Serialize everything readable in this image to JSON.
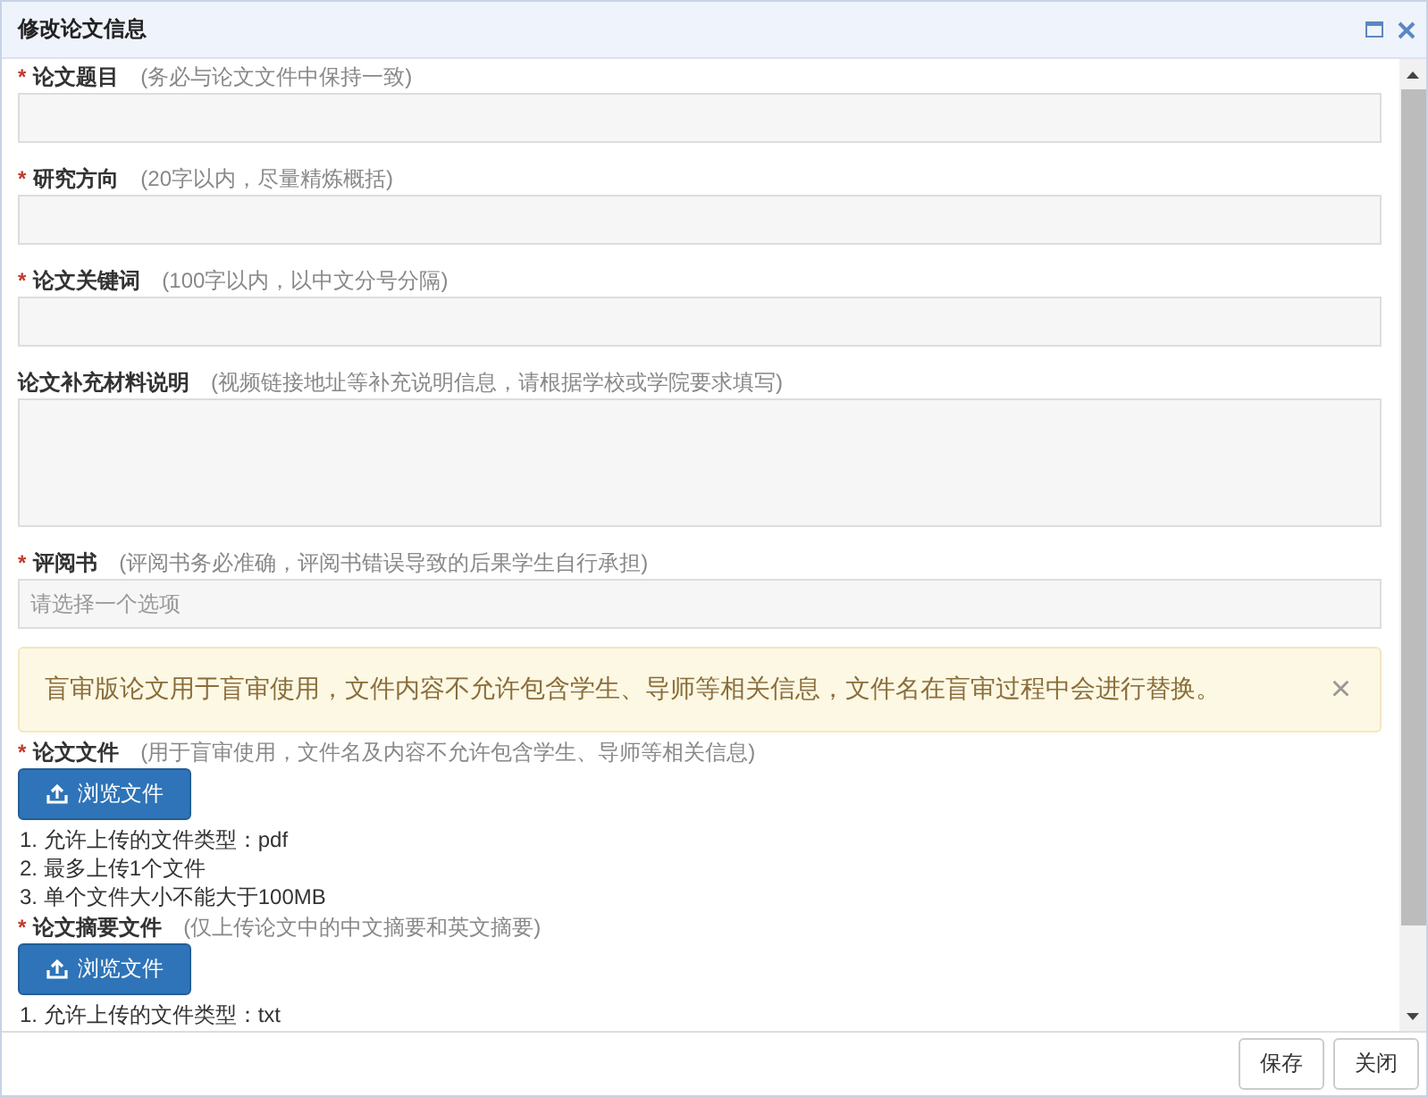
{
  "window": {
    "title": "修改论文信息"
  },
  "fields": [
    {
      "kind": "input",
      "marker": "*",
      "label": "论文题目",
      "hint": "(务必与论文文件中保持一致)"
    },
    {
      "kind": "input",
      "marker": "*",
      "label": "研究方向",
      "hint": "(20字以内，尽量精炼概括)"
    },
    {
      "kind": "input",
      "marker": "*",
      "label": "论文关键词",
      "hint": "(100字以内，以中文分号分隔)"
    },
    {
      "kind": "textarea",
      "label": "论文补充材料说明",
      "hint": "(视频链接地址等补充说明信息，请根据学校或学院要求填写)"
    },
    {
      "kind": "select",
      "marker": "*",
      "label": "评阅书",
      "hint": "(评阅书务必准确，评阅书错误导致的后果学生自行承担)",
      "placeholder": "请选择一个选项"
    },
    {
      "kind": "alert",
      "text": "盲审版论文用于盲审使用，文件内容不允许包含学生、导师等相关信息，文件名在盲审过程中会进行替换。",
      "close": "×"
    },
    {
      "kind": "file",
      "marker": "*",
      "label": "论文文件",
      "hint": "(用于盲审使用，文件名及内容不允许包含学生、导师等相关信息)",
      "button": "浏览文件",
      "notes": [
        "1. 允许上传的文件类型：pdf",
        "2. 最多上传1个文件",
        "3. 单个文件大小不能大于100MB"
      ]
    },
    {
      "kind": "file",
      "marker": "*",
      "label": "论文摘要文件",
      "hint": "(仅上传论文中的中文摘要和英文摘要)",
      "button": "浏览文件",
      "notes": [
        "1. 允许上传的文件类型：txt"
      ]
    }
  ],
  "buttons": [
    "保存",
    "关闭"
  ]
}
